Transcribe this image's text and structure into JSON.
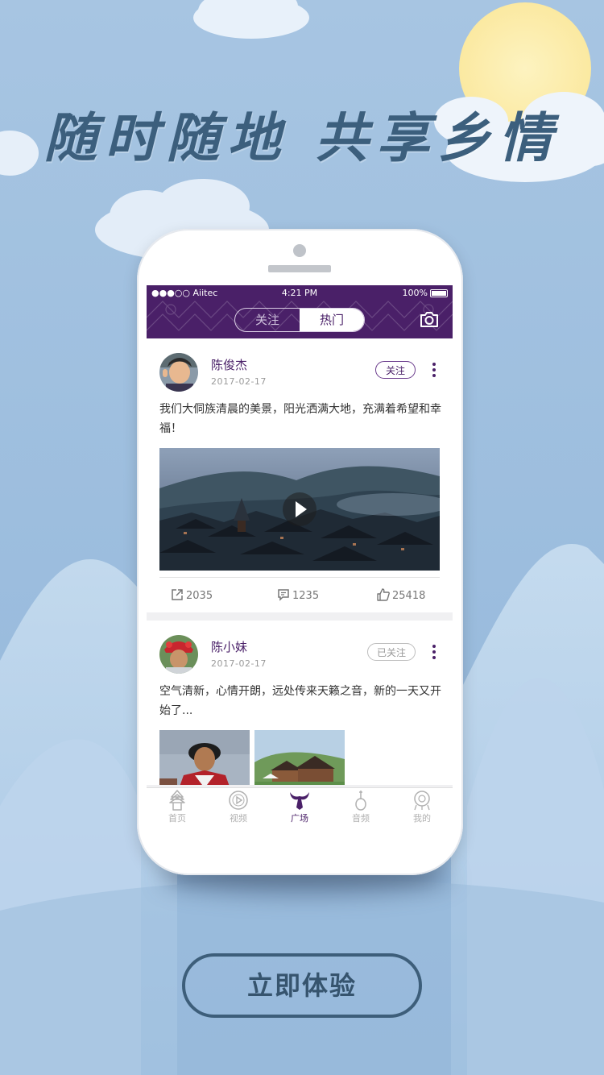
{
  "promo": {
    "slogan": "随时随地  共享乡情",
    "cta_label": "立即体验"
  },
  "statusbar": {
    "carrier": "●●●○○ Aiitec",
    "time": "4:21 PM",
    "battery": "100%"
  },
  "header": {
    "tabs": [
      {
        "label": "关注",
        "active": false
      },
      {
        "label": "热门",
        "active": true
      }
    ],
    "camera_icon": "camera-icon"
  },
  "posts": [
    {
      "user": "陈俊杰",
      "date": "2017-02-17",
      "follow_label": "关注",
      "text": "我们大侗族清晨的美景，阳光洒满大地，充满着希望和幸福！",
      "media": "video",
      "stats": {
        "shares": "2035",
        "comments": "1235",
        "likes": "25418"
      }
    },
    {
      "user": "陈小妹",
      "date": "2017-02-17",
      "follow_label": "已关注",
      "text": "空气清新，心情开朗，远处传来天籁之音，新的一天又开始了...",
      "media": "images"
    }
  ],
  "tabbar": [
    {
      "label": "首页",
      "icon": "drum-tower-icon",
      "active": false
    },
    {
      "label": "视频",
      "icon": "play-circle-icon",
      "active": false
    },
    {
      "label": "广场",
      "icon": "buffalo-horn-icon",
      "active": true
    },
    {
      "label": "音频",
      "icon": "pipa-icon",
      "active": false
    },
    {
      "label": "我的",
      "icon": "silver-ornament-icon",
      "active": false
    }
  ],
  "colors": {
    "brand": "#4a2068",
    "sky": "#9dbddc",
    "slogan": "#3c5f7d"
  }
}
